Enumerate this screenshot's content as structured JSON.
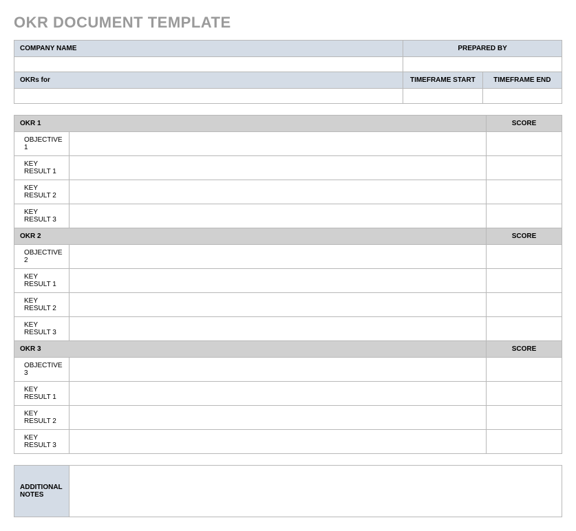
{
  "title": "OKR DOCUMENT TEMPLATE",
  "topHeader": {
    "companyLabel": "COMPANY NAME",
    "preparedByLabel": "PREPARED BY",
    "companyValue": "",
    "preparedByValue": "",
    "okrsForLabel": "OKRs for",
    "timeframeStartLabel": "TIMEFRAME START",
    "timeframeEndLabel": "TIMEFRAME END",
    "okrsForValue": "",
    "timeframeStartValue": "",
    "timeframeEndValue": ""
  },
  "scoreLabel": "SCORE",
  "okrs": [
    {
      "header": "OKR 1",
      "rows": [
        {
          "label": "OBJECTIVE 1",
          "value": "",
          "score": ""
        },
        {
          "label": "KEY RESULT 1",
          "value": "",
          "score": ""
        },
        {
          "label": "KEY RESULT 2",
          "value": "",
          "score": ""
        },
        {
          "label": "KEY RESULT 3",
          "value": "",
          "score": ""
        }
      ]
    },
    {
      "header": "OKR 2",
      "rows": [
        {
          "label": "OBJECTIVE 2",
          "value": "",
          "score": ""
        },
        {
          "label": "KEY RESULT 1",
          "value": "",
          "score": ""
        },
        {
          "label": "KEY RESULT 2",
          "value": "",
          "score": ""
        },
        {
          "label": "KEY RESULT 3",
          "value": "",
          "score": ""
        }
      ]
    },
    {
      "header": "OKR 3",
      "rows": [
        {
          "label": "OBJECTIVE 3",
          "value": "",
          "score": ""
        },
        {
          "label": "KEY RESULT 1",
          "value": "",
          "score": ""
        },
        {
          "label": "KEY RESULT 2",
          "value": "",
          "score": ""
        },
        {
          "label": "KEY RESULT 3",
          "value": "",
          "score": ""
        }
      ]
    }
  ],
  "notes": {
    "label": "ADDITIONAL NOTES",
    "value": ""
  }
}
